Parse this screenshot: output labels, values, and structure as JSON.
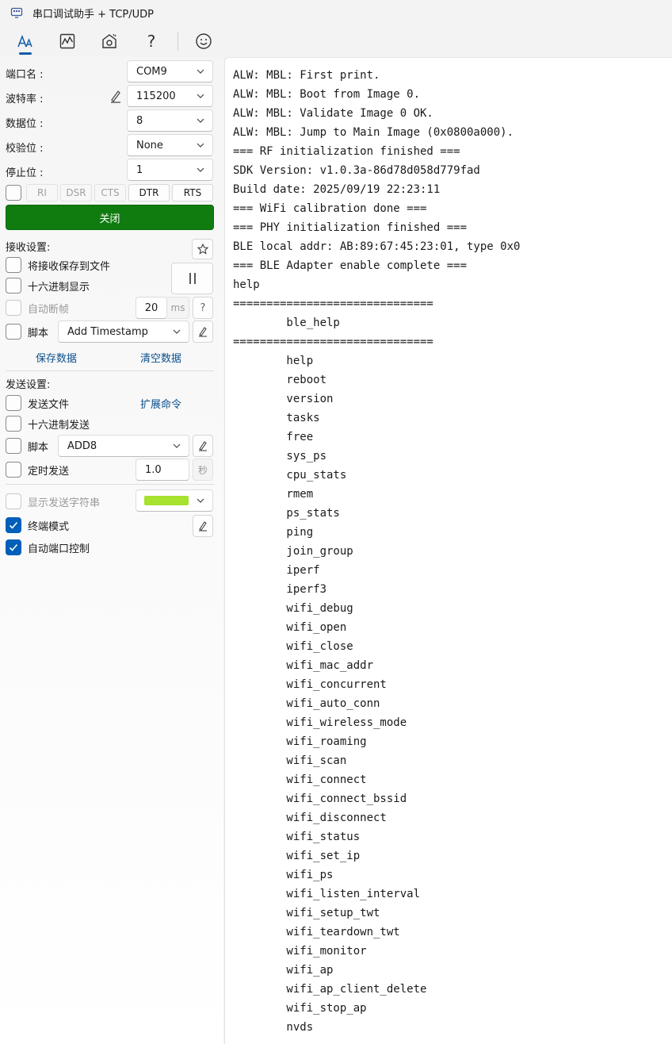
{
  "window": {
    "title": "串口调试助手 + TCP/UDP"
  },
  "toolbar": {
    "items": [
      {
        "name": "font-icon"
      },
      {
        "name": "chart-icon"
      },
      {
        "name": "settings-icon"
      },
      {
        "name": "help-icon",
        "glyph": "?"
      },
      {
        "name": "smile-icon"
      }
    ]
  },
  "serial": {
    "port_label": "端口名 :",
    "port_value": "COM9",
    "baud_label": "波特率 :",
    "baud_value": "115200",
    "databits_label": "数据位 :",
    "databits_value": "8",
    "parity_label": "校验位 :",
    "parity_value": "None",
    "stopbits_label": "停止位 :",
    "stopbits_value": "1",
    "signals": [
      "RI",
      "DSR",
      "CTS",
      "DTR",
      "RTS"
    ],
    "close_label": "关闭"
  },
  "receive": {
    "section_label": "接收设置:",
    "save_to_file_label": "将接收保存到文件",
    "hex_display_label": "十六进制显示",
    "auto_frame_label": "自动断帧",
    "auto_frame_value": "20",
    "auto_frame_unit": "ms",
    "help_glyph": "?",
    "script_label": "脚本",
    "script_value": "Add Timestamp",
    "save_data_label": "保存数据",
    "clear_data_label": "清空数据"
  },
  "send": {
    "section_label": "发送设置:",
    "send_file_label": "发送文件",
    "ext_cmd_label": "扩展命令",
    "hex_send_label": "十六进制发送",
    "script_label": "脚本",
    "script_value": "ADD8",
    "timed_send_label": "定时发送",
    "timed_value": "1.0",
    "timed_unit": "秒",
    "show_send_label": "显示发送字符串",
    "show_send_color": "#a6e22e",
    "terminal_mode_label": "终端模式",
    "auto_port_label": "自动端口控制"
  },
  "terminal": {
    "lines": [
      "ALW: MBL: First print.",
      "ALW: MBL: Boot from Image 0.",
      "ALW: MBL: Validate Image 0 OK.",
      "ALW: MBL: Jump to Main Image (0x0800a000).",
      "=== RF initialization finished ===",
      "SDK Version: v1.0.3a-86d78d058d779fad",
      "Build date: 2025/09/19 22:23:11",
      "=== WiFi calibration done ===",
      "=== PHY initialization finished ===",
      "BLE local addr: AB:89:67:45:23:01, type 0x0",
      "=== BLE Adapter enable complete ===",
      "help",
      "==============================",
      "        ble_help",
      "==============================",
      "        help",
      "        reboot",
      "        version",
      "        tasks",
      "        free",
      "        sys_ps",
      "        cpu_stats",
      "        rmem",
      "        ps_stats",
      "        ping",
      "        join_group",
      "        iperf",
      "        iperf3",
      "        wifi_debug",
      "        wifi_open",
      "        wifi_close",
      "        wifi_mac_addr",
      "        wifi_concurrent",
      "        wifi_auto_conn",
      "        wifi_wireless_mode",
      "        wifi_roaming",
      "        wifi_scan",
      "        wifi_connect",
      "        wifi_connect_bssid",
      "        wifi_disconnect",
      "        wifi_status",
      "        wifi_set_ip",
      "        wifi_ps",
      "        wifi_listen_interval",
      "        wifi_setup_twt",
      "        wifi_teardown_twt",
      "        wifi_monitor",
      "        wifi_ap",
      "        wifi_ap_client_delete",
      "        wifi_stop_ap",
      "        nvds"
    ]
  },
  "colors": {
    "accent": "#005fb8",
    "close_button": "#107c10",
    "link": "#0a4f8c"
  }
}
